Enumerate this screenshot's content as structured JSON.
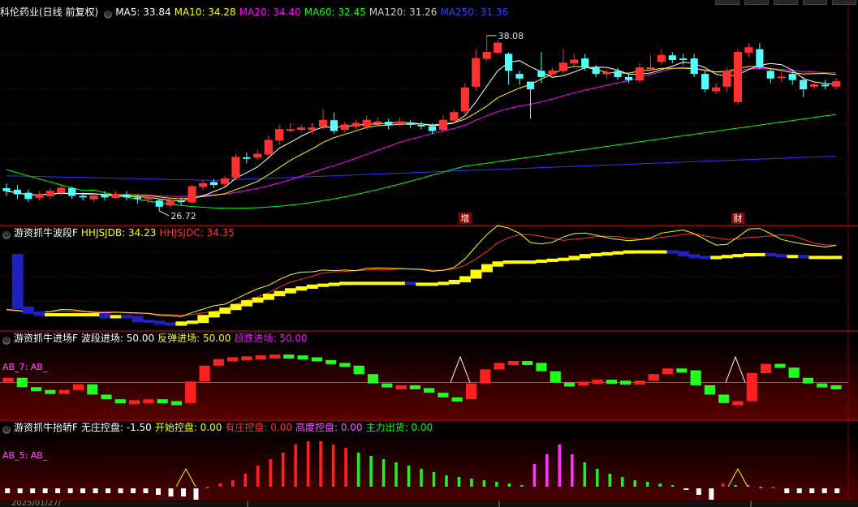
{
  "colors": {
    "bg": "#000000",
    "up": "#ff3232",
    "down": "#54ffff",
    "ma5": "#ffffff",
    "ma10": "#ffff00",
    "ma20": "#ff00ff",
    "ma60": "#00ff00",
    "ma120": "#aaaaaa",
    "ma250": "#3333ff",
    "hl": "#ffff00",
    "hc": "#ff3030"
  },
  "main": {
    "title": "科伦药业(日线 前复权)",
    "indicators": [
      {
        "label": "MA5: 33.84",
        "color": "#ffffff"
      },
      {
        "label": "MA10: 34.28",
        "color": "#ffff00"
      },
      {
        "label": "MA20: 34.40",
        "color": "#ff00ff"
      },
      {
        "label": "MA60: 32.45",
        "color": "#00ff00"
      },
      {
        "label": "MA120: 31.26",
        "color": "#cccccc"
      },
      {
        "label": "MA250: 31.36",
        "color": "#3b3bff"
      }
    ],
    "high_label": "38.08",
    "low_label": "26.72",
    "marker_zeng": "增",
    "marker_cai": "财"
  },
  "p1": {
    "title": "游资抓牛波段F",
    "indicators": [
      {
        "label": "HHJSJDB: 34.23",
        "color": "#ffff00"
      },
      {
        "label": "HHJSJDC: 34.35",
        "color": "#ff3030"
      }
    ]
  },
  "p2": {
    "title": "游资抓牛进场F",
    "indicators": [
      {
        "label": "波段进场: 50.00",
        "color": "#ffffff"
      },
      {
        "label": "反弹进场: 50.00",
        "color": "#ffff00"
      },
      {
        "label": "超跌进场: 50.00",
        "color": "#ff00ff"
      }
    ],
    "ab_label": "AB_7: AB_"
  },
  "p3": {
    "title": "游资抓牛抬轿F",
    "indicators": [
      {
        "label": "无庄控盘: -1.50",
        "color": "#ffffff"
      },
      {
        "label": "开始控盘: 0.00",
        "color": "#ffff00"
      },
      {
        "label": "有庄控盘: 0.00",
        "color": "#ff3030"
      },
      {
        "label": "高度控盘: 0.00",
        "color": "#ff55ff"
      },
      {
        "label": "主力出货: 0.00",
        "color": "#00ff00"
      }
    ],
    "ab_label": "AB_5: AB_"
  },
  "date_label": "2025/01/27/",
  "chart_data": {
    "type": "candlestick",
    "candles": [
      [
        28.2,
        28.0,
        28.5,
        27.7
      ],
      [
        28.1,
        27.8,
        28.4,
        27.5
      ],
      [
        27.9,
        27.5,
        28.1,
        27.3
      ],
      [
        27.6,
        27.8,
        28.0,
        27.4
      ],
      [
        27.7,
        28.0,
        28.2,
        27.5
      ],
      [
        27.9,
        28.2,
        28.4,
        27.7
      ],
      [
        28.2,
        27.7,
        28.3,
        27.5
      ],
      [
        27.7,
        27.6,
        27.9,
        27.4
      ],
      [
        27.5,
        27.7,
        27.9,
        27.3
      ],
      [
        27.8,
        27.6,
        28.0,
        27.4
      ],
      [
        27.6,
        27.8,
        28.0,
        27.5
      ],
      [
        27.8,
        27.6,
        28.0,
        27.4
      ],
      [
        27.6,
        27.5,
        27.8,
        27.2
      ],
      [
        27.5,
        27.6,
        27.8,
        27.2
      ],
      [
        27.4,
        27.0,
        27.5,
        26.72
      ],
      [
        27.1,
        27.4,
        27.5,
        26.9
      ],
      [
        27.4,
        27.3,
        27.6,
        27.1
      ],
      [
        27.3,
        28.3,
        28.4,
        27.2
      ],
      [
        28.3,
        28.5,
        28.7,
        28.1
      ],
      [
        28.6,
        28.4,
        28.8,
        28.2
      ],
      [
        28.5,
        28.8,
        29.0,
        28.3
      ],
      [
        28.9,
        30.2,
        30.4,
        28.8
      ],
      [
        30.2,
        30.1,
        30.5,
        29.8
      ],
      [
        30.2,
        30.4,
        30.7,
        30.0
      ],
      [
        30.4,
        31.3,
        31.6,
        30.2
      ],
      [
        31.3,
        32.0,
        32.3,
        31.0
      ],
      [
        32.0,
        32.0,
        32.4,
        31.8
      ],
      [
        32.0,
        32.1,
        32.3,
        31.8
      ],
      [
        32.0,
        32.1,
        32.4,
        31.7
      ],
      [
        32.2,
        32.6,
        33.3,
        32.0
      ],
      [
        32.6,
        31.9,
        33.1,
        31.7
      ],
      [
        32.0,
        32.3,
        32.5,
        31.8
      ],
      [
        32.2,
        32.4,
        32.6,
        32.0
      ],
      [
        32.2,
        32.6,
        32.9,
        32.0
      ],
      [
        32.4,
        32.5,
        32.8,
        32.2
      ],
      [
        32.5,
        32.3,
        32.7,
        32.0
      ],
      [
        32.4,
        32.5,
        32.8,
        32.2
      ],
      [
        32.4,
        32.3,
        32.6,
        32.1
      ],
      [
        32.3,
        32.2,
        32.5,
        32.0
      ],
      [
        32.2,
        31.9,
        32.4,
        31.7
      ],
      [
        32.0,
        32.6,
        32.9,
        31.8
      ],
      [
        32.6,
        33.1,
        33.3,
        32.4
      ],
      [
        33.2,
        34.7,
        35.0,
        33.0
      ],
      [
        34.8,
        36.6,
        37.2,
        34.5
      ],
      [
        36.6,
        37.0,
        38.08,
        36.4
      ],
      [
        37.0,
        37.6,
        37.8,
        36.9
      ],
      [
        36.9,
        35.8,
        37.0,
        34.9
      ],
      [
        35.6,
        35.3,
        35.8,
        34.9
      ],
      [
        35.1,
        34.6,
        35.0,
        32.7
      ],
      [
        35.8,
        35.4,
        37.0,
        35.0
      ],
      [
        35.6,
        35.8,
        36.0,
        35.5
      ],
      [
        35.8,
        36.3,
        37.2,
        35.6
      ],
      [
        36.3,
        36.5,
        36.9,
        36.0
      ],
      [
        36.6,
        36.0,
        36.9,
        35.8
      ],
      [
        36.0,
        35.6,
        36.2,
        35.4
      ],
      [
        35.6,
        35.7,
        35.9,
        35.3
      ],
      [
        35.8,
        35.4,
        36.0,
        35.2
      ],
      [
        35.4,
        35.2,
        35.6,
        35.0
      ],
      [
        35.2,
        36.0,
        36.3,
        35.0
      ],
      [
        36.0,
        36.0,
        36.8,
        35.8
      ],
      [
        36.4,
        36.8,
        37.2,
        36.2
      ],
      [
        36.8,
        36.5,
        37.0,
        36.3
      ],
      [
        36.6,
        36.5,
        36.9,
        36.2
      ],
      [
        36.6,
        35.6,
        36.9,
        35.4
      ],
      [
        35.6,
        34.6,
        35.8,
        34.4
      ],
      [
        34.5,
        34.7,
        35.0,
        34.3
      ],
      [
        34.8,
        35.8,
        36.0,
        34.4
      ],
      [
        33.8,
        37.0,
        37.2,
        33.6
      ],
      [
        37.0,
        37.3,
        37.6,
        36.7
      ],
      [
        37.2,
        36.0,
        37.6,
        35.9
      ],
      [
        35.8,
        35.3,
        36.0,
        35.0
      ],
      [
        35.4,
        35.4,
        35.7,
        35.1
      ],
      [
        35.6,
        35.2,
        35.9,
        34.9
      ],
      [
        35.2,
        34.6,
        35.4,
        34.1
      ],
      [
        34.8,
        34.9,
        35.1,
        34.6
      ],
      [
        34.9,
        34.8,
        35.2,
        34.6
      ],
      [
        34.8,
        35.1,
        35.3,
        34.6
      ]
    ],
    "p1_low": [
      34.0,
      28.3,
      27.8,
      27.6,
      27.6,
      27.6,
      27.6,
      27.6,
      27.6,
      27.3,
      27.4,
      27.3,
      26.9,
      26.8,
      26.6,
      26.5,
      26.7,
      26.8,
      27.4,
      27.8,
      28.2,
      28.6,
      29.0,
      29.3,
      29.7,
      30.0,
      30.3,
      30.5,
      30.7,
      30.8,
      30.9,
      31.0,
      31.0,
      31.0,
      31.0,
      31.0,
      31.0,
      30.9,
      30.9,
      30.9,
      31.0,
      31.2,
      31.6,
      32.3,
      32.9,
      33.2,
      33.3,
      33.3,
      33.3,
      33.4,
      33.5,
      33.6,
      33.8,
      34.0,
      34.1,
      34.2,
      34.3,
      34.4,
      34.4,
      34.4,
      34.4,
      34.3,
      34.0,
      33.8,
      33.7,
      33.8,
      33.9,
      34.0,
      34.1,
      34.1,
      34.0,
      33.9,
      33.9,
      33.8,
      33.8,
      33.8,
      33.8
    ],
    "p2_vals": [
      5,
      -5,
      -8,
      -11,
      -8,
      -2,
      -13,
      -18,
      -20,
      -19,
      -18,
      -20,
      -22,
      1,
      18,
      25,
      27,
      28,
      29,
      30,
      29,
      27,
      24,
      21,
      18,
      9,
      -1,
      -5,
      -3,
      -6,
      -11,
      -16,
      -18,
      -1,
      14,
      21,
      23,
      21,
      12,
      0,
      -3,
      1,
      3,
      2,
      0,
      2,
      9,
      15,
      13,
      -3,
      -13,
      -22,
      -20,
      10,
      20,
      16,
      5,
      -1,
      -3,
      -4
    ],
    "p3_vals": [
      -3,
      -3,
      -3,
      -3,
      -3,
      -3,
      -3,
      -3,
      -3,
      -3,
      -3,
      -3,
      -4,
      -5,
      -5,
      -7,
      0,
      2,
      4,
      8,
      13,
      17,
      21,
      26,
      28,
      28,
      26,
      24,
      21,
      19,
      17,
      15,
      13,
      11,
      9,
      7,
      6,
      5,
      4,
      3,
      2,
      1,
      14,
      20,
      26,
      20,
      15,
      11,
      8,
      6,
      4,
      3,
      2,
      1,
      -1,
      -4,
      -7,
      2,
      1,
      1,
      0,
      0,
      -3,
      -3,
      -3,
      -3,
      -3
    ],
    "p3_magenta": [
      42,
      43,
      44,
      45,
      59,
      60
    ],
    "p3_white": [
      0,
      1,
      2,
      3,
      4,
      5,
      6,
      7,
      8,
      9,
      10,
      11,
      12,
      13,
      14,
      15,
      54,
      55,
      56,
      57,
      61,
      62,
      63,
      64,
      65,
      66
    ]
  }
}
